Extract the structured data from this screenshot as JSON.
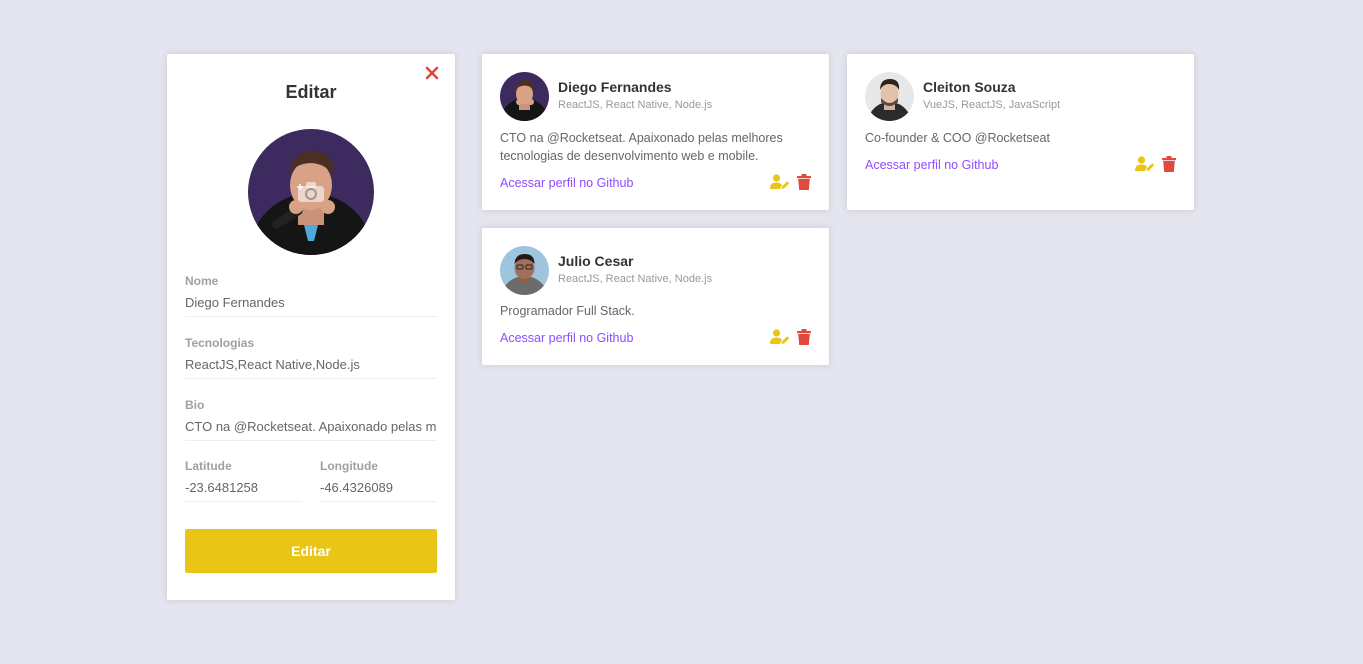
{
  "edit_form": {
    "title": "Editar",
    "fields": {
      "name": {
        "label": "Nome",
        "value": "Diego Fernandes"
      },
      "techs": {
        "label": "Tecnologias",
        "value": "ReactJS,React Native,Node.js"
      },
      "bio": {
        "label": "Bio",
        "value": "CTO na @Rocketseat. Apaixonado pelas melhores tecnologias de desenvolvimento web e mobile."
      },
      "latitude": {
        "label": "Latitude",
        "value": "-23.6481258"
      },
      "longitude": {
        "label": "Longitude",
        "value": "-46.4326089"
      }
    },
    "submit_label": "Editar"
  },
  "devs": [
    {
      "name": "Diego Fernandes",
      "techs": "ReactJS, React Native, Node.js",
      "bio": "CTO na @Rocketseat. Apaixonado pelas melhores tecnologias de desenvolvimento web e mobile.",
      "link_label": "Acessar perfil no Github"
    },
    {
      "name": "Cleiton Souza",
      "techs": "VueJS, ReactJS, JavaScript",
      "bio": "Co-founder & COO @Rocketseat",
      "link_label": "Acessar perfil no Github"
    },
    {
      "name": "Julio Cesar",
      "techs": "ReactJS, React Native, Node.js",
      "bio": "Programador Full Stack.",
      "link_label": "Acessar perfil no Github"
    }
  ],
  "colors": {
    "background": "#e5e5ef",
    "accent_yellow": "#e8c517",
    "link_purple": "#8e4dff",
    "delete_red": "#e04a3d"
  },
  "icons": {
    "close": "close-icon",
    "camera": "camera-icon",
    "edit_user": "user-edit-icon",
    "delete": "trash-icon"
  }
}
